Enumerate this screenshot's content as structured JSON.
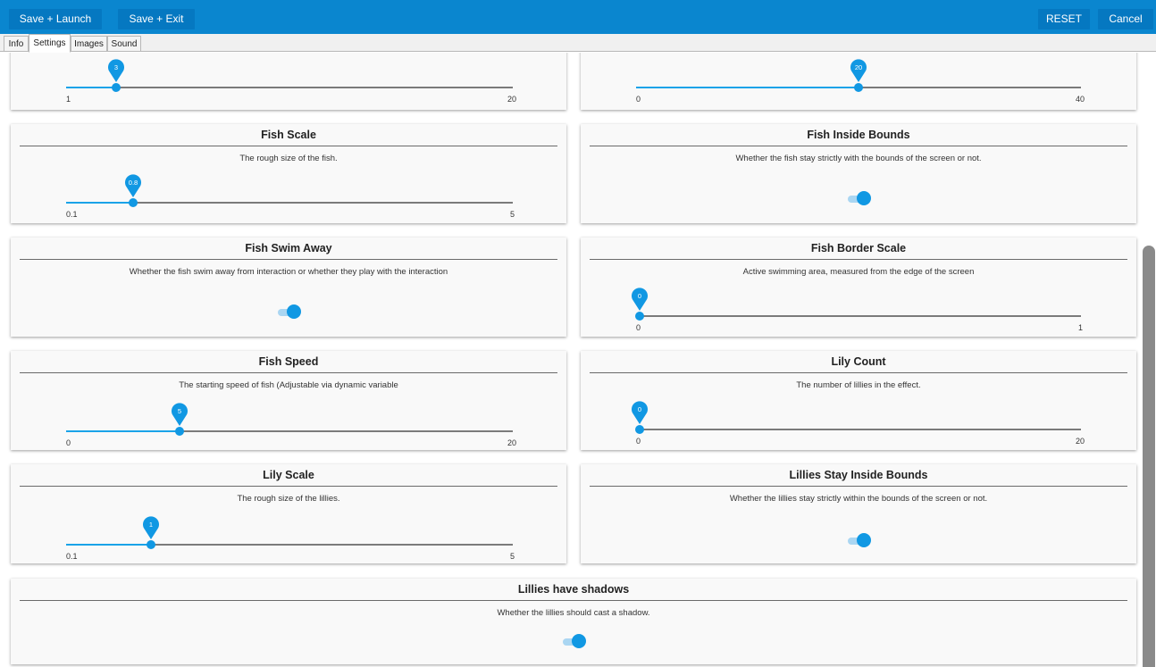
{
  "toolbar": {
    "save_launch": "Save + Launch",
    "save_exit": "Save + Exit",
    "reset": "RESET",
    "cancel": "Cancel"
  },
  "tabs": [
    {
      "label": "Info",
      "active": false
    },
    {
      "label": "Settings",
      "active": true
    },
    {
      "label": "Images",
      "active": false
    },
    {
      "label": "Sound",
      "active": false
    }
  ],
  "colors": {
    "accent": "#0a86cf",
    "slider": "#1198e3",
    "card_bg": "#f9f9f9"
  },
  "settings": [
    {
      "type": "slider",
      "min": "1",
      "max": "20",
      "value": "3"
    },
    {
      "type": "slider",
      "min": "0",
      "max": "40",
      "value": "20"
    },
    {
      "title": "Fish Scale",
      "desc": "The rough size of the fish.",
      "type": "slider",
      "min": "0.1",
      "max": "5",
      "value": "0.8"
    },
    {
      "title": "Fish Inside Bounds",
      "desc": "Whether the fish stay strictly with the bounds of the screen or not.",
      "type": "toggle",
      "on": true
    },
    {
      "title": "Fish Swim Away",
      "desc": "Whether the fish swim away from interaction or whether they play with the interaction",
      "type": "toggle",
      "on": true
    },
    {
      "title": "Fish Border Scale",
      "desc": "Active swimming area, measured from the edge of the screen",
      "type": "slider",
      "min": "0",
      "max": "1",
      "value": "0"
    },
    {
      "title": "Fish Speed",
      "desc": "The starting speed of fish (Adjustable via dynamic variable",
      "type": "slider",
      "min": "0",
      "max": "20",
      "value": "5"
    },
    {
      "title": "Lily Count",
      "desc": "The number of lillies in the effect.",
      "type": "slider",
      "min": "0",
      "max": "20",
      "value": "0"
    },
    {
      "title": "Lily Scale",
      "desc": "The rough size of the lillies.",
      "type": "slider",
      "min": "0.1",
      "max": "5",
      "value": "1"
    },
    {
      "title": "Lillies Stay Inside Bounds",
      "desc": "Whether the lillies stay strictly within the bounds of the screen or not.",
      "type": "toggle",
      "on": true
    },
    {
      "title": "Lillies have shadows",
      "desc": "Whether the lillies should cast a shadow.",
      "type": "toggle",
      "on": true
    }
  ]
}
